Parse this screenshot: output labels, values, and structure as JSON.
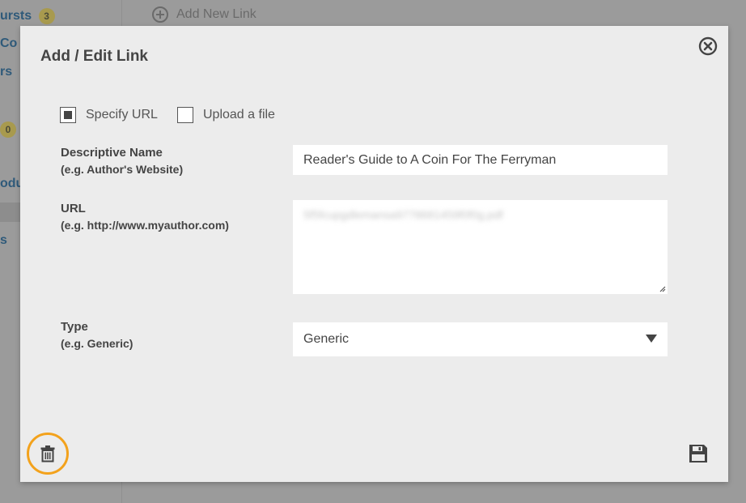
{
  "background": {
    "sidebar_items": [
      {
        "label": "ursts",
        "badge": "3"
      },
      {
        "label": "Co",
        "badge": ""
      },
      {
        "label": "rs",
        "badge": ""
      },
      {
        "label": "",
        "badge": "0"
      },
      {
        "label": "odu",
        "badge": ""
      },
      {
        "label": "s",
        "badge": ""
      }
    ],
    "add_new_link_label": "Add New Link"
  },
  "modal": {
    "title": "Add / Edit Link",
    "source_options": {
      "specify_url_label": "Specify URL",
      "specify_url_checked": true,
      "upload_file_label": "Upload a file",
      "upload_file_checked": false
    },
    "fields": {
      "name": {
        "label": "Descriptive Name",
        "hint": "(e.g. Author's Website)",
        "value": "Reader's Guide to A Coin For The Ferryman"
      },
      "url": {
        "label": "URL",
        "hint": "(e.g. http://www.myauthor.com)",
        "value": "5f5fcupgdlemansa9778681459f0f0g.pdf"
      },
      "type": {
        "label": "Type",
        "hint": "(e.g. Generic)",
        "value": "Generic"
      }
    }
  },
  "colors": {
    "highlight_ring": "#f3a21c",
    "overlay": "#9b9b9b",
    "modal_bg": "#ececec"
  },
  "icons": {
    "close": "close-circle-icon",
    "delete": "trash-icon",
    "save": "floppy-disk-icon",
    "dropdown": "triangle-down-icon",
    "add": "plus-circle-icon"
  }
}
